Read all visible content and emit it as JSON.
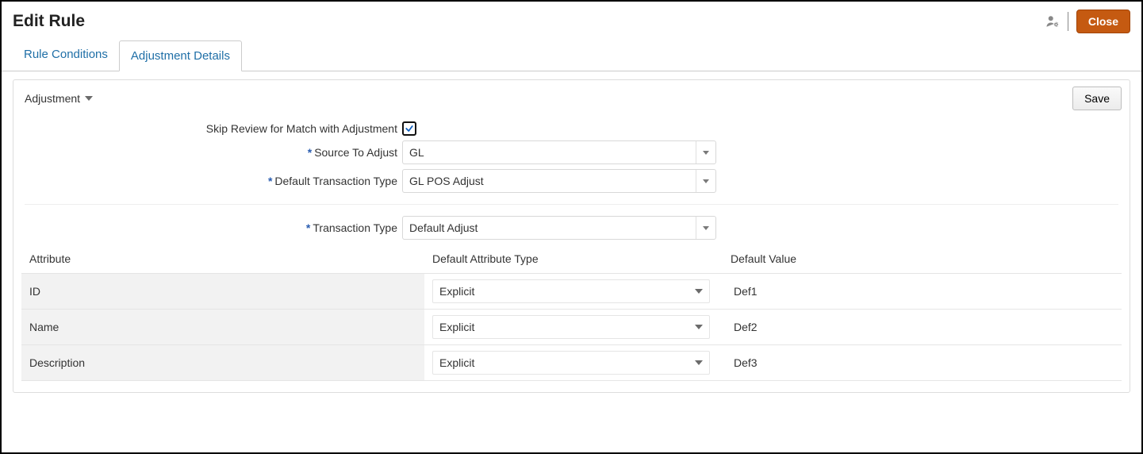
{
  "header": {
    "title": "Edit Rule",
    "close_label": "Close"
  },
  "tabs": {
    "rule_conditions": "Rule Conditions",
    "adjustment_details": "Adjustment Details"
  },
  "toolbar": {
    "adjustment_label": "Adjustment",
    "save_label": "Save"
  },
  "form": {
    "skip_review_label": "Skip Review for Match with Adjustment",
    "skip_review_checked": true,
    "source_to_adjust_label": "Source To Adjust",
    "source_to_adjust_value": "GL",
    "default_txn_type_label": "Default Transaction Type",
    "default_txn_type_value": "GL POS Adjust",
    "txn_type_label": "Transaction Type",
    "txn_type_value": "Default Adjust"
  },
  "table": {
    "headers": {
      "attribute": "Attribute",
      "default_attr_type": "Default Attribute Type",
      "default_value": "Default Value"
    },
    "rows": [
      {
        "attribute": "ID",
        "type": "Explicit",
        "value": "Def1"
      },
      {
        "attribute": "Name",
        "type": "Explicit",
        "value": "Def2"
      },
      {
        "attribute": "Description",
        "type": "Explicit",
        "value": "Def3"
      }
    ]
  }
}
